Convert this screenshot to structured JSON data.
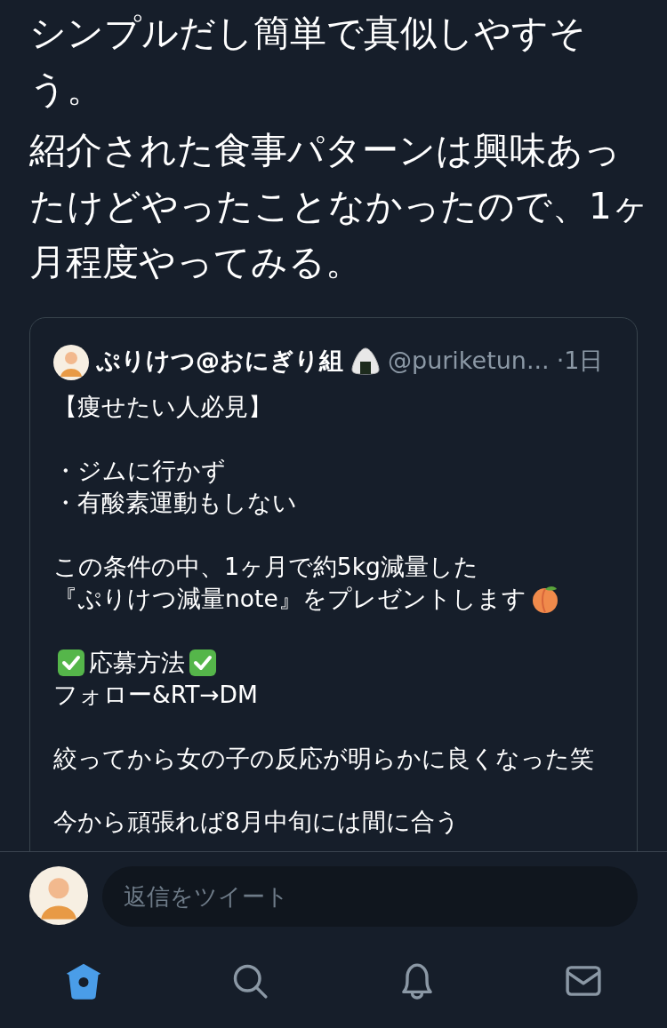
{
  "tweet": {
    "paragraphs": [
      "シンプルだし簡単で真似しやすそう。",
      "紹介された食事パターンは興味あったけどやったことなかったので、1ヶ月程度やってみる。"
    ]
  },
  "quote": {
    "author": {
      "name": "ぷりけつ@おにぎり組",
      "handle": "@puriketun...",
      "time": "·1日"
    },
    "paragraphs": [
      [
        [
          {
            "kind": "text",
            "text": "【痩せたい人必見】"
          }
        ]
      ],
      [
        [
          {
            "kind": "text",
            "text": "・ジムに行かず"
          }
        ],
        [
          {
            "kind": "text",
            "text": "・有酸素運動もしない"
          }
        ]
      ],
      [
        [
          {
            "kind": "text",
            "text": "この条件の中、1ヶ月で約5kg減量した"
          }
        ],
        [
          {
            "kind": "text",
            "text": "『ぷりけつ減量note』をプレゼントします"
          },
          {
            "kind": "peach"
          }
        ]
      ],
      [
        [
          {
            "kind": "check"
          },
          {
            "kind": "text",
            "text": "応募方法"
          },
          {
            "kind": "check"
          }
        ],
        [
          {
            "kind": "text",
            "text": "フォロー&RT→DM"
          }
        ]
      ],
      [
        [
          {
            "kind": "text",
            "text": "絞ってから女の子の反応が明らかに良くなった笑"
          }
        ]
      ],
      [
        [
          {
            "kind": "text",
            "text": "今から頑張れば8月中旬には間に合う"
          }
        ]
      ]
    ]
  },
  "reply": {
    "placeholder": "返信をツイート"
  },
  "nav": [
    {
      "selected": true
    },
    {
      "selected": false
    },
    {
      "selected": false
    },
    {
      "selected": false
    }
  ]
}
